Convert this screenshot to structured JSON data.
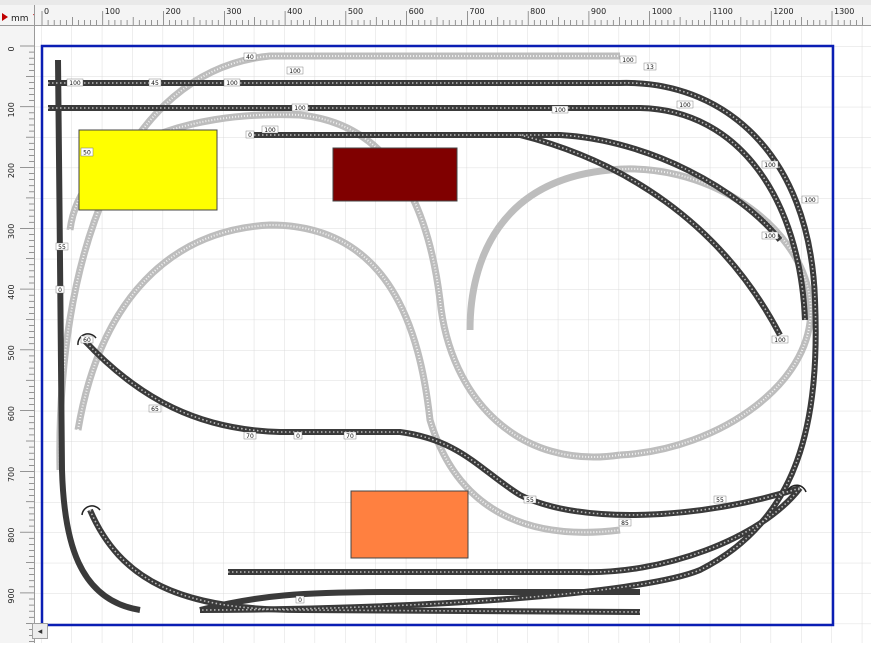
{
  "ruler": {
    "unit": "mm",
    "x_ticks": [
      "0",
      "100",
      "200",
      "300",
      "400",
      "500",
      "600",
      "700",
      "800",
      "900",
      "1000",
      "1100",
      "1200",
      "1300"
    ],
    "y_ticks": [
      "0",
      "100",
      "200",
      "300",
      "400",
      "500",
      "600",
      "700",
      "800",
      "900"
    ]
  },
  "plan": {
    "zones": [
      {
        "label": "50",
        "color": "#ffff00"
      },
      {
        "label": "",
        "color": "#800000"
      },
      {
        "label": "",
        "color": "#ff8040"
      }
    ],
    "boundary_color": "#0a1eb4",
    "track_labels": [
      "40",
      "45",
      "100",
      "100",
      "100",
      "100",
      "100",
      "100",
      "100",
      "100",
      "100",
      "100",
      "100",
      "100",
      "13",
      "55",
      "60",
      "65",
      "70",
      "70",
      "55",
      "85",
      "55",
      "0",
      "0",
      "0",
      "0"
    ]
  },
  "scroll": {
    "left_arrow": "◂"
  }
}
